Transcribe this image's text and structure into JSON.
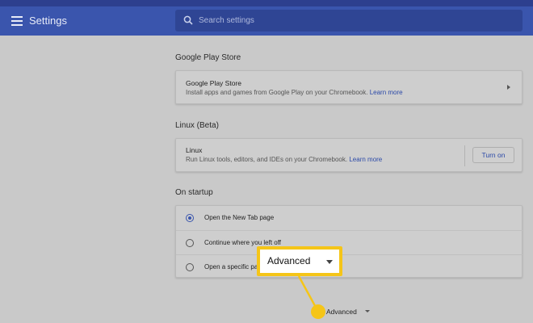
{
  "header": {
    "title": "Settings",
    "menu_icon": "hamburger-menu-icon",
    "search_icon": "search-icon",
    "search_placeholder": "Search settings"
  },
  "sections": {
    "play_store": {
      "title": "Google Play Store",
      "row_title": "Google Play Store",
      "row_sub": "Install apps and games from Google Play on your Chromebook.",
      "link": "Learn more"
    },
    "linux": {
      "title": "Linux (Beta)",
      "row_title": "Linux",
      "row_sub": "Run Linux tools, editors, and IDEs on your Chromebook.",
      "link": "Learn more",
      "button": "Turn on"
    },
    "startup": {
      "title": "On startup",
      "options": [
        {
          "label": "Open the New Tab page",
          "checked": true
        },
        {
          "label": "Continue where you left off",
          "checked": false
        },
        {
          "label": "Open a specific pa",
          "checked": false
        }
      ]
    }
  },
  "callout": {
    "label": "Advanced"
  },
  "advanced": {
    "label": "Advanced"
  },
  "colors": {
    "header": "#3a55ad",
    "search": "#2f4594",
    "background": "#c9c9c9",
    "accent": "#2c4aa8",
    "callout_border": "#f5c518"
  }
}
